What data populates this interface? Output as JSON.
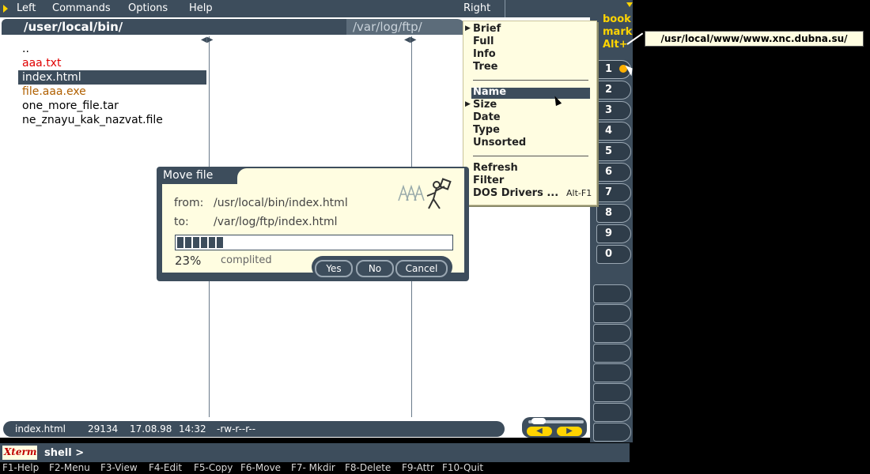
{
  "menubar": {
    "items": [
      "Left",
      "Commands",
      "Options",
      "Help"
    ],
    "right_label": "Right"
  },
  "panels": {
    "left_path": "/user/local/bin/",
    "right_path": "/var/log/ftp/"
  },
  "files": [
    {
      "name": "..",
      "color": "#000000"
    },
    {
      "name": "aaa.txt",
      "color": "#e00000"
    },
    {
      "name": "index.html",
      "color": "#ffffff",
      "selected": true
    },
    {
      "name": "file.aaa.exe",
      "color": "#b06000"
    },
    {
      "name": "one_more_file.tar",
      "color": "#000000"
    },
    {
      "name": "ne_znayu_kak_nazvat.file",
      "color": "#000000"
    }
  ],
  "dropdown": {
    "group1": [
      "Brief",
      "Full",
      "Info",
      "Tree"
    ],
    "group2": [
      "Name",
      "Size",
      "Date",
      "Type",
      "Unsorted"
    ],
    "group3": [
      "Refresh",
      "Filter",
      "DOS Drivers ..."
    ],
    "dos_shortcut": "Alt-F1",
    "selected": "Name"
  },
  "dialog": {
    "title": "Move file",
    "from_label": "from:",
    "from_value": "/usr/local/bin/index.html",
    "to_label": "to:",
    "to_value": "/var/log/ftp/index.html",
    "percent": "23%",
    "status_text": "complited",
    "progress": 0.23,
    "buttons": {
      "yes": "Yes",
      "no": "No",
      "cancel": "Cancel"
    }
  },
  "bookmarks": {
    "header": [
      "book",
      "mark",
      "Alt+"
    ],
    "numbers": [
      "1",
      "2",
      "3",
      "4",
      "5",
      "6",
      "7",
      "8",
      "9",
      "0"
    ]
  },
  "tooltip": "/usr/local/www/www.xnc.dubna.su/",
  "statusbar": {
    "filename": "index.html",
    "size": "29134",
    "date": "17.08.98",
    "time": "14:32",
    "perms": "-rw-r--r--"
  },
  "shell": {
    "logo": "Xterm",
    "prompt": "shell >"
  },
  "fkeys": [
    "F1-Help",
    "F2-Menu",
    "F3-View",
    "F4-Edit",
    "F5-Copy",
    "F6-Move",
    "F7- Mkdir",
    "F8-Delete",
    "F9-Attr",
    "F10-Quit"
  ]
}
